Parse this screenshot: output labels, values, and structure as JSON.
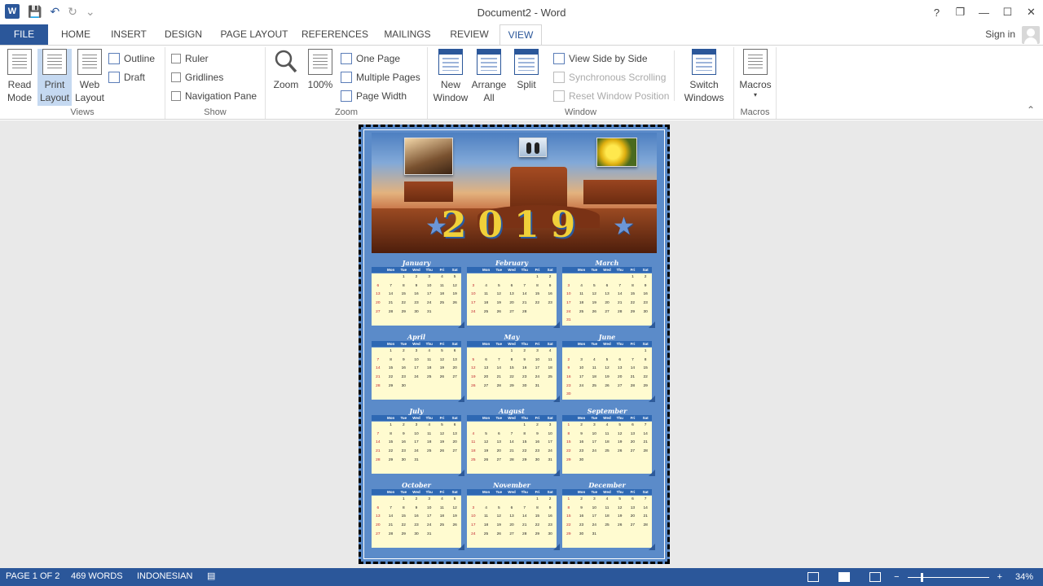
{
  "window": {
    "title": "Document2 - Word",
    "controls": [
      "?",
      "❐",
      "—",
      "☐",
      "✕"
    ]
  },
  "qat": {
    "icons": [
      "word-icon",
      "save-icon",
      "undo-icon",
      "redo-icon",
      "customize-icon"
    ]
  },
  "tabs": [
    "FILE",
    "HOME",
    "INSERT",
    "DESIGN",
    "PAGE LAYOUT",
    "REFERENCES",
    "MAILINGS",
    "REVIEW",
    "VIEW"
  ],
  "active_tab": "VIEW",
  "signin": "Sign in",
  "ribbon": {
    "views": {
      "label": "Views",
      "read_mode": "Read Mode",
      "print_layout": "Print Layout",
      "web_layout": "Web Layout",
      "outline": "Outline",
      "draft": "Draft",
      "selected": "Print Layout"
    },
    "show": {
      "label": "Show",
      "ruler": "Ruler",
      "gridlines": "Gridlines",
      "navigation_pane": "Navigation Pane"
    },
    "zoom": {
      "label": "Zoom",
      "zoom": "Zoom",
      "hundred": "100%",
      "one_page": "One Page",
      "multiple_pages": "Multiple Pages",
      "page_width": "Page Width"
    },
    "window": {
      "label": "Window",
      "new_window": "New Window",
      "arrange_all": "Arrange All",
      "split": "Split",
      "view_side_by_side": "View Side by Side",
      "synchronous_scrolling": "Synchronous Scrolling",
      "reset_window_position": "Reset Window Position",
      "switch_windows": "Switch Windows"
    },
    "macros": {
      "label": "Macros",
      "macros": "Macros"
    }
  },
  "calendar": {
    "year": "2019",
    "weekday_headers": [
      "",
      "Mon",
      "Tue",
      "Wed",
      "Thu",
      "Fri",
      "Sat"
    ],
    "months": [
      {
        "name": "January",
        "start": 2,
        "days": 31
      },
      {
        "name": "February",
        "start": 5,
        "days": 28
      },
      {
        "name": "March",
        "start": 5,
        "days": 31
      },
      {
        "name": "April",
        "start": 1,
        "days": 30
      },
      {
        "name": "May",
        "start": 3,
        "days": 31
      },
      {
        "name": "June",
        "start": 6,
        "days": 30
      },
      {
        "name": "July",
        "start": 1,
        "days": 31
      },
      {
        "name": "August",
        "start": 4,
        "days": 31
      },
      {
        "name": "September",
        "start": 0,
        "days": 30
      },
      {
        "name": "October",
        "start": 2,
        "days": 31
      },
      {
        "name": "November",
        "start": 5,
        "days": 30
      },
      {
        "name": "December",
        "start": 0,
        "days": 31
      }
    ]
  },
  "statusbar": {
    "page": "PAGE 1 OF 2",
    "words": "469 WORDS",
    "language": "INDONESIAN",
    "zoom": "34%",
    "zoom_fraction": 0.34
  },
  "colors": {
    "brand": "#2b579a",
    "page_background": "#5b8bc9",
    "calendar_header": "#2e68b3",
    "calendar_cell": "#fffbd0",
    "sunday": "#c0202a",
    "year_text": "#f0d03a"
  }
}
